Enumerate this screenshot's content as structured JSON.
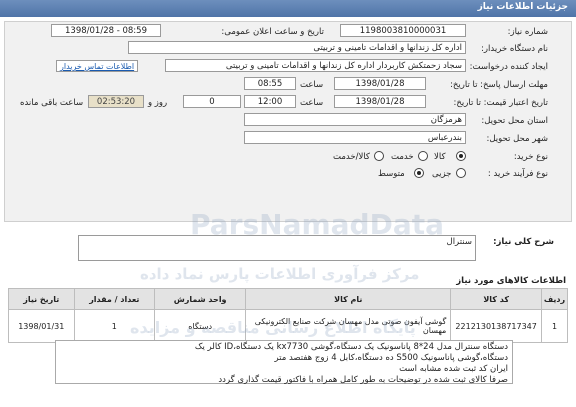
{
  "header": {
    "title": "جزئیات اطلاعات نیاز"
  },
  "fields": {
    "need_number_label": "شماره نیاز:",
    "need_number": "1198003810000031",
    "announce_label": "تاریخ و ساعت اعلان عمومی:",
    "announce_value": "1398/01/28 - 08:59",
    "buyer_label": "نام دستگاه خریدار:",
    "buyer_value": "اداره کل زندانها و اقدامات تامینی و تربیتی",
    "creator_label": "ایجاد کننده درخواست:",
    "creator_value": "سجاد زحمتکش کاربردار اداره کل زندانها و اقدامات تامینی و تربیتی",
    "contact_link": "اطلاعات تماس خریدار",
    "deadline_label": "مهلت ارسال پاسخ: تا تاریخ:",
    "deadline_date": "1398/01/28",
    "hour_label": "ساعت",
    "deadline_time": "08:55",
    "validity_label": "تاریخ اعتبار قیمت: تا تاریخ:",
    "validity_date": "1398/01/28",
    "validity_time": "12:00",
    "days_value": "0",
    "days_label": "روز و",
    "timer_value": "02:53:20",
    "remaining_label": "ساعت باقی مانده",
    "province_label": "استان محل تحویل:",
    "province_value": "هرمزگان",
    "city_label": "شهر محل تحویل:",
    "city_value": "بندرعباس",
    "purchase_type_label": "نوع خرید:",
    "opt_goods": "کالا",
    "opt_service": "خدمت",
    "opt_goods_service": "کالا/خدمت",
    "process_label": "نوع فرآیند خرید :",
    "opt_partial": "جزیی",
    "opt_medium": "متوسط"
  },
  "summary": {
    "label": "شرح کلی نیاز:",
    "value": "سنترال"
  },
  "items_section": {
    "title": "اطلاعات کالاهای مورد نیاز",
    "columns": [
      "ردیف",
      "کد کالا",
      "نام کالا",
      "واحد شمارش",
      "تعداد / مقدار",
      "تاریخ نیاز"
    ],
    "rows": [
      [
        "1",
        "2212130138717347",
        "گوشی آیفون صوتی مدل مهسان شرکت صنایع الکترونیکی مهسان",
        "دستگاه",
        "1",
        "1398/01/31"
      ]
    ]
  },
  "notes": {
    "line1": "دستگاه سنترال مدل 24*8 پاناسونیک یک دستگاه،گوشی kx7730 یک دستگاه،ID کالر یک",
    "line2": "دستگاه،گوشی پاناسونیک S500 ده دستگاه،کابل 4 زوج هفتصد متر",
    "line3": "ایران کد ثبت شده مشابه است",
    "line4": "صرفا کالای ثبت شده در توضیحات به طور کامل همراه با فاکتور قیمت گذاری گردد"
  },
  "watermark": {
    "line1": "مرکز فرآوری اطلاعات پارس نماد داده",
    "brand": "ParsNamadData",
    "line2": "پایگاه اطلاع رسانی مناقصه و مزایده"
  },
  "colors": {
    "header_bg": "#5a7eb2",
    "link": "#1a5bb0",
    "timer_bg": "#e8e0c8"
  }
}
